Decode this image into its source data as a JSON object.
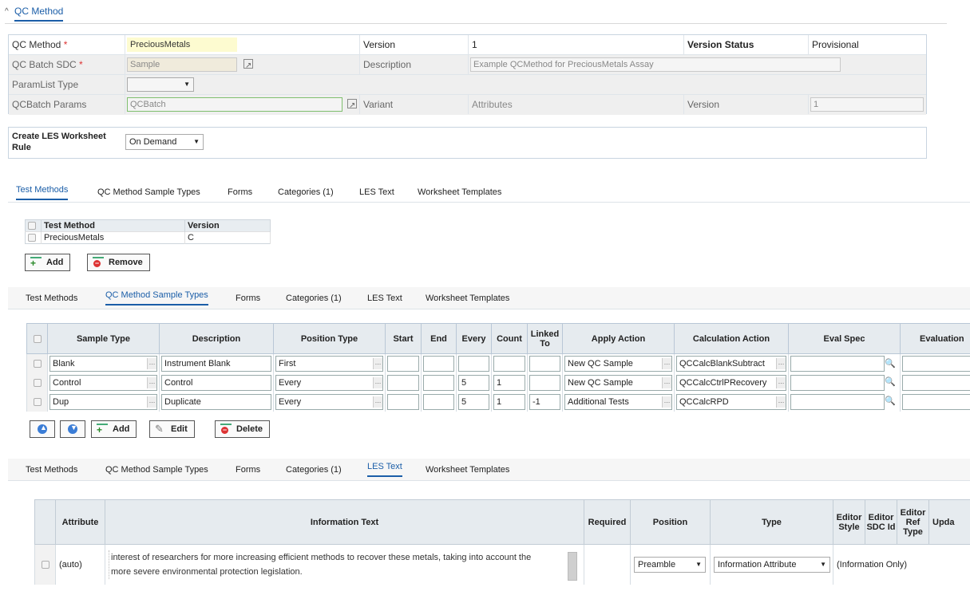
{
  "section": {
    "title": "QC Method"
  },
  "form": {
    "qc_method_label": "QC Method",
    "required_mark": "*",
    "qc_method_value": "PreciousMetals",
    "version_label": "Version",
    "version_value": "1",
    "version_status_label": "Version Status",
    "version_status_value": "Provisional",
    "qc_batch_sdc_label": "QC Batch SDC",
    "qc_batch_sdc_value": "Sample",
    "description_label": "Description",
    "description_value": "Example QCMethod for PreciousMetals Assay",
    "paramlist_type_label": "ParamList Type",
    "paramlist_type_value": "",
    "qcbatch_params_label": "QCBatch Params",
    "qcbatch_params_value": "QCBatch",
    "variant_label": "Variant",
    "variant_value": "Attributes",
    "version2_label": "Version",
    "version2_value": "1",
    "les_rule_label": "Create LES Worksheet Rule",
    "les_rule_value": "On Demand"
  },
  "tabs": [
    "Test Methods",
    "QC Method Sample Types",
    "Forms",
    "Categories (1)",
    "LES Text",
    "Worksheet Templates"
  ],
  "test_methods": {
    "headers": [
      "Test Method",
      "Version"
    ],
    "rows": [
      {
        "method": "PreciousMetals",
        "version": "C"
      }
    ],
    "add_label": "Add",
    "remove_label": "Remove"
  },
  "sample_types": {
    "headers": [
      "Sample Type",
      "Description",
      "Position Type",
      "Start",
      "End",
      "Every",
      "Count",
      "Linked To",
      "Apply Action",
      "Calculation Action",
      "Eval Spec",
      "Evaluation"
    ],
    "rows": [
      {
        "sample_type": "Blank",
        "description": "Instrument Blank",
        "position_type": "First",
        "start": "",
        "end": "",
        "every": "",
        "count": "",
        "linked_to": "",
        "apply_action": "New QC Sample",
        "calc_action": "QCCalcBlankSubtract"
      },
      {
        "sample_type": "Control",
        "description": "Control",
        "position_type": "Every",
        "start": "",
        "end": "",
        "every": "5",
        "count": "1",
        "linked_to": "",
        "apply_action": "New QC Sample",
        "calc_action": "QCCalcCtrlPRecovery"
      },
      {
        "sample_type": "Dup",
        "description": "Duplicate",
        "position_type": "Every",
        "start": "",
        "end": "",
        "every": "5",
        "count": "1",
        "linked_to": "-1",
        "apply_action": "Additional Tests",
        "calc_action": "QCCalcRPD"
      }
    ],
    "add_label": "Add",
    "edit_label": "Edit",
    "delete_label": "Delete"
  },
  "les_text": {
    "headers": [
      "Attribute",
      "Information Text",
      "Required",
      "Position",
      "Type",
      "Editor Style",
      "Editor SDC Id",
      "Editor Ref Type",
      "Upda"
    ],
    "row": {
      "attribute": "(auto)",
      "text_line1": "interest of researchers for more increasing efficient methods to recover these metals, taking into account the",
      "text_line2": "more severe environmental protection legislation.",
      "position": "Preamble",
      "type": "Information Attribute",
      "editor_style": "(Information Only)"
    }
  },
  "icons": {
    "caret": "caret-up-icon",
    "external": "external-link-icon",
    "lookup": "ellipsis-icon",
    "search": "magnifier-icon",
    "move_up": "arrow-up-icon",
    "move_down": "arrow-down-icon"
  },
  "colors": {
    "accent": "#1b5ea8",
    "required": "#dd3333",
    "highlight": "#fdfbd0",
    "valid_border": "#7fbf6e"
  }
}
